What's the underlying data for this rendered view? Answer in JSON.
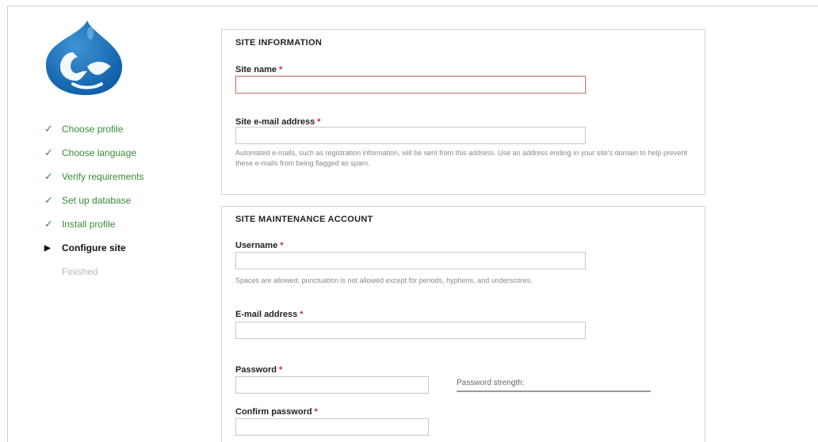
{
  "sidebar": {
    "steps": [
      {
        "label": "Choose profile",
        "status": "done"
      },
      {
        "label": "Choose language",
        "status": "done"
      },
      {
        "label": "Verify requirements",
        "status": "done"
      },
      {
        "label": "Set up database",
        "status": "done"
      },
      {
        "label": "Install profile",
        "status": "done"
      },
      {
        "label": "Configure site",
        "status": "current"
      },
      {
        "label": "Finished",
        "status": "pending"
      }
    ],
    "icons": {
      "done": "✓",
      "current": "▶"
    }
  },
  "site_information": {
    "legend": "SITE INFORMATION",
    "site_name_label": "Site name",
    "site_name_value": "",
    "site_email_label": "Site e-mail address",
    "site_email_value": "",
    "site_email_desc": "Automated e-mails, such as registration information, will be sent from this address. Use an address ending in your site's domain to help prevent these e-mails from being flagged as spam."
  },
  "maintenance_account": {
    "legend": "SITE MAINTENANCE ACCOUNT",
    "username_label": "Username",
    "username_value": "",
    "username_desc": "Spaces are allowed; punctuation is not allowed except for periods, hyphens, and underscores.",
    "email_label": "E-mail address",
    "email_value": "",
    "password_label": "Password",
    "password_value": "",
    "password_strength_label": "Password strength:",
    "confirm_password_label": "Confirm password",
    "confirm_password_value": ""
  },
  "required_marker": "*",
  "colors": {
    "done": "#3a8a3a",
    "required": "#cc2a2a",
    "logo": "#1a6fb5"
  }
}
